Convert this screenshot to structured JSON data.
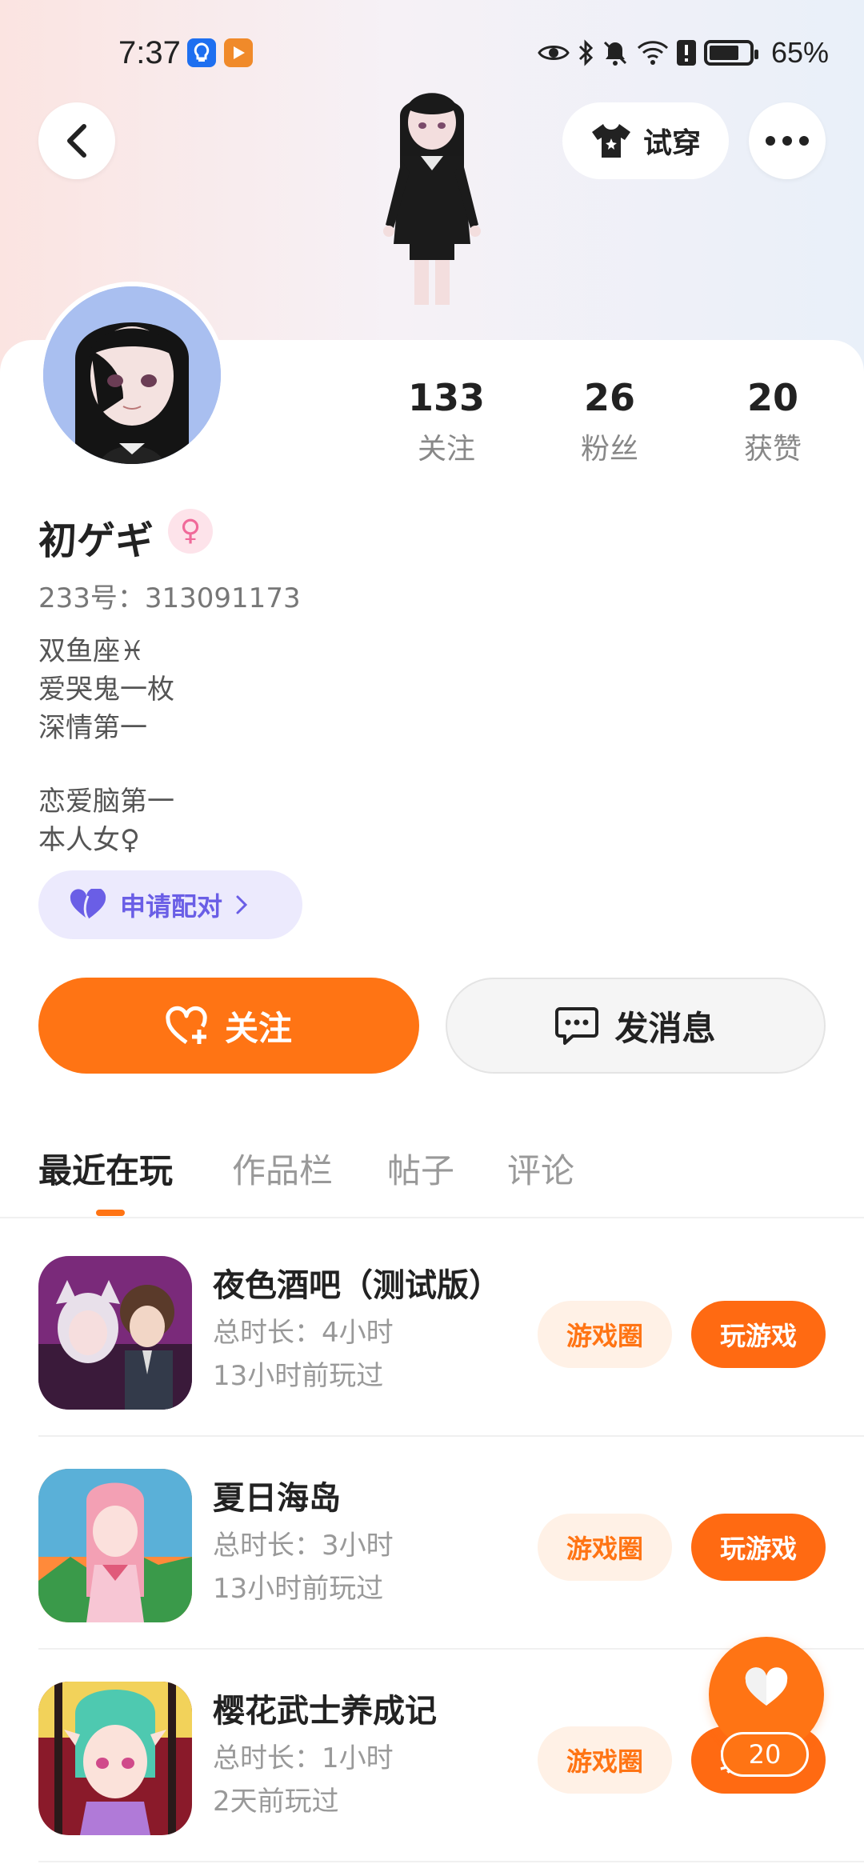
{
  "status_bar": {
    "time": "7:37",
    "battery": "65%"
  },
  "header": {
    "back_icon": "chevron-left-icon",
    "try_on_label": "试穿",
    "more_icon": "more-dots-icon"
  },
  "profile": {
    "stats": [
      {
        "value": "133",
        "label": "关注"
      },
      {
        "value": "26",
        "label": "粉丝"
      },
      {
        "value": "20",
        "label": "获赞"
      }
    ],
    "username": "初ゲギ",
    "gender_symbol": "♀",
    "uid": "233号：313091173",
    "bio": [
      "双鱼座♓",
      "爱哭鬼一枚",
      "深情第一",
      "",
      "恋爱脑第一",
      "本人女♀"
    ],
    "match_label": "申请配对",
    "follow_label": "关注",
    "message_label": "发消息"
  },
  "tabs": [
    {
      "label": "最近在玩",
      "active": true
    },
    {
      "label": "作品栏",
      "active": false
    },
    {
      "label": "帖子",
      "active": false
    },
    {
      "label": "评论",
      "active": false
    }
  ],
  "games": [
    {
      "title": "夜色酒吧（测试版）",
      "duration": "总时长：4小时",
      "last_played": "13小时前玩过",
      "circle_label": "游戏圈",
      "play_label": "玩游戏"
    },
    {
      "title": "夏日海岛",
      "duration": "总时长：3小时",
      "last_played": "13小时前玩过",
      "circle_label": "游戏圈",
      "play_label": "玩游戏"
    },
    {
      "title": "樱花武士养成记",
      "duration": "总时长：1小时",
      "last_played": "2天前玩过",
      "circle_label": "游戏圈",
      "play_label": "玩游戏"
    }
  ],
  "fab": {
    "count": "20"
  },
  "colors": {
    "accent": "#ff7414",
    "match": "#6a5ee6"
  }
}
